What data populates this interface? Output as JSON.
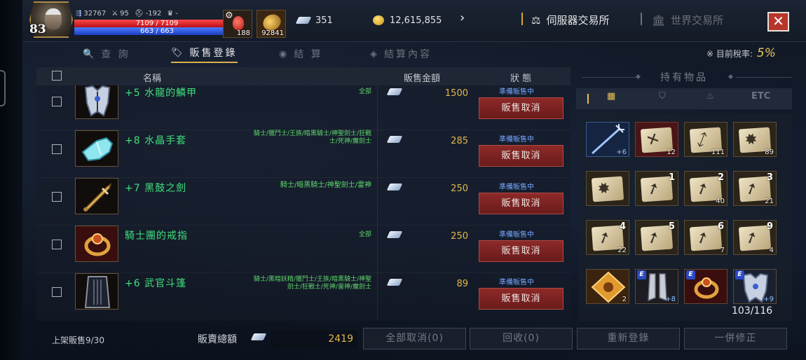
{
  "player": {
    "level": "83",
    "stat_power": "32767",
    "stat_attack": "95",
    "stat_defense": "-192",
    "stat_trophy": "-",
    "hp": "7109 / 7109",
    "mp": "663 / 663",
    "potion_count": "188",
    "orb_count": "92841"
  },
  "currency": {
    "diamonds": "351",
    "gold": "12,615,855"
  },
  "exchange": {
    "server_label": "伺服器交易所",
    "world_label": "世界交易所"
  },
  "tabs": [
    {
      "label": "查 詢"
    },
    {
      "label": "販售登錄"
    },
    {
      "label": "結 算"
    },
    {
      "label": "結算內容"
    }
  ],
  "tax": {
    "label": "※ 目前稅率:",
    "value": "5%"
  },
  "list": {
    "headers": {
      "name": "名稱",
      "price": "販售金額",
      "status": "狀 態"
    },
    "rows": [
      {
        "name": "+5 水龍的鱗甲",
        "classes": "全部",
        "price": "1500",
        "status": "準備販售中",
        "cancel": "販售取消"
      },
      {
        "name": "+8 水晶手套",
        "classes": "騎士/獵鬥士/王族/暗黑騎士/神聖劍士/狂戰士/死神/魔劍士",
        "price": "285",
        "status": "準備販售中",
        "cancel": "販售取消"
      },
      {
        "name": "+7 黑鼓之劍",
        "classes": "騎士/暗黑騎士/神聖劍士/雷神",
        "price": "250",
        "status": "準備販售中",
        "cancel": "販售取消"
      },
      {
        "name": "騎士團的戒指",
        "classes": "全部",
        "price": "250",
        "status": "準備販售中",
        "cancel": "販售取消"
      },
      {
        "name": "+6 武官斗篷",
        "classes": "騎士/黑暗妖精/獵鬥士/王族/暗黑騎士/神聖劍士/狂戰士/死神/雷神/魔劍士",
        "price": "89",
        "status": "準備販售中",
        "cancel": "販售取消"
      }
    ]
  },
  "inventory": {
    "title": "持有物品",
    "tab_etc": "ETC",
    "count": "103/116",
    "cells": [
      {
        "type": "staff",
        "label": "+6"
      },
      {
        "type": "scroll-red",
        "label": "12"
      },
      {
        "type": "scroll",
        "label": "111"
      },
      {
        "type": "scroll-burst",
        "label": "89"
      },
      {
        "type": "scroll-burst",
        "label": ""
      },
      {
        "type": "scroll-arrow",
        "num": "1",
        "label": ""
      },
      {
        "type": "scroll-arrow",
        "num": "2",
        "label": "40"
      },
      {
        "type": "scroll-arrow",
        "num": "3",
        "label": "21"
      },
      {
        "type": "scroll-arrow",
        "num": "4",
        "label": "22"
      },
      {
        "type": "scroll-arrow",
        "num": "5",
        "label": ""
      },
      {
        "type": "scroll-arrow",
        "num": "6",
        "label": "7"
      },
      {
        "type": "scroll-arrow",
        "num": "9",
        "label": "4"
      },
      {
        "type": "rune",
        "label": "2"
      },
      {
        "type": "boots",
        "e": "E",
        "label": "+8"
      },
      {
        "type": "ring",
        "e": "E",
        "label": ""
      },
      {
        "type": "armor",
        "e": "E",
        "label": "+9"
      }
    ]
  },
  "bottom": {
    "on_sale": "上架販售9/30",
    "total_label": "販賣總額",
    "total_value": "2419",
    "btn_cancel_all": "全部取消(0)",
    "btn_recall": "回收(0)",
    "btn_reregister": "重新登錄",
    "btn_modify": "一併修正"
  }
}
